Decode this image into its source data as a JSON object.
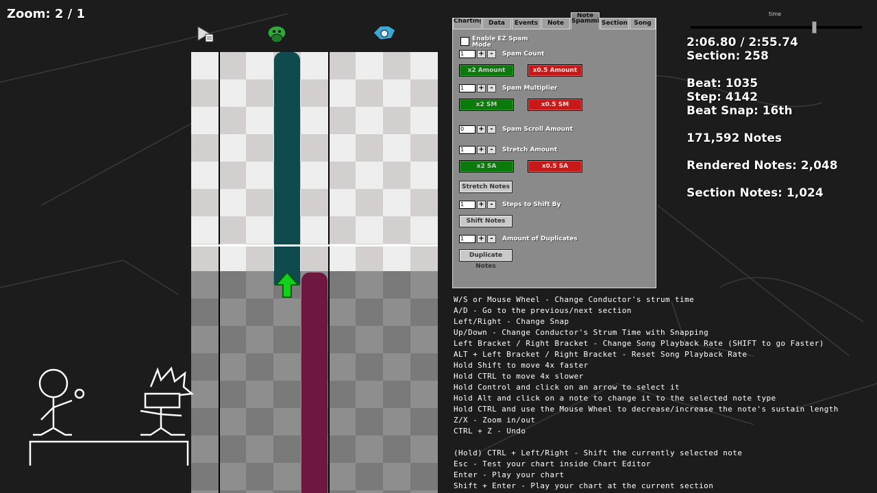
{
  "zoom_label": "Zoom: 2 / 1",
  "timeline": {
    "label": "time",
    "progress": 0.72
  },
  "info": {
    "time": "2:06.80 / 2:55.74",
    "section": "Section: 258",
    "beat": "Beat: 1035",
    "step": "Step: 4142",
    "beat_snap": "Beat Snap: 16th",
    "notes": "171,592 Notes",
    "rendered_notes": "Rendered Notes: 2,048",
    "section_notes": "Section Notes: 1,024"
  },
  "header_icons": [
    "playback-icon",
    "opponent-health-icon",
    "player-health-icon"
  ],
  "tabs": [
    {
      "label": "Charting"
    },
    {
      "label": "Data"
    },
    {
      "label": "Events"
    },
    {
      "label": "Note"
    },
    {
      "label": "Note Spamming"
    },
    {
      "label": "Section"
    },
    {
      "label": "Song"
    }
  ],
  "panel": {
    "ez_spam_label": "Enable EZ Spam Mode",
    "spam_count": {
      "value": "1",
      "label": "Spam Count",
      "x2": "x2 Amount",
      "x05": "x0.5 Amount"
    },
    "spam_multiplier": {
      "value": "1",
      "label": "Spam Multiplier",
      "x2": "x2 SM",
      "x05": "x0.5 SM"
    },
    "spam_scroll": {
      "value": "0",
      "label": "Spam Scroll Amount"
    },
    "stretch": {
      "value": "1",
      "label": "Stretch Amount",
      "x2": "x2 SA",
      "x05": "x0.5 SA",
      "button": "Stretch Notes"
    },
    "shift": {
      "value": "1",
      "label": "Steps to Shift By",
      "button": "Shift Notes"
    },
    "duplicate": {
      "value": "1",
      "label": "Amount of Duplicates",
      "button": "Duplicate Notes"
    },
    "plus": "+",
    "minus": "-"
  },
  "help_lines": [
    "W/S or Mouse Wheel - Change Conductor's strum time",
    "A/D - Go to the previous/next section",
    "Left/Right - Change Snap",
    "Up/Down - Change Conductor's Strum Time with Snapping",
    "Left Bracket / Right Bracket - Change Song Playback Rate (SHIFT to go Faster)",
    "ALT + Left Bracket / Right Bracket - Reset Song Playback Rate",
    "Hold Shift to move 4x faster",
    "Hold CTRL to move 4x slower",
    "Hold Control and click on an arrow to select it",
    "Hold Alt and click on a note to change it to the selected note type",
    "Hold CTRL and use the Mouse Wheel to decrease/increase the note's sustain length",
    "Z/X - Zoom in/out",
    "CTRL + Z - Undo",
    "",
    "(Hold) CTRL + Left/Right - Shift the currently selected note",
    "Esc - Test your chart inside Chart Editor",
    "Enter - Play your chart",
    "Shift + Enter - Play your chart at the current section"
  ],
  "colors": {
    "accent_green": "#0a7a0a",
    "accent_red": "#c81818",
    "sustain_teal": "#0f4a4e",
    "sustain_magenta": "#6e1840",
    "note_green": "#12d11a"
  }
}
